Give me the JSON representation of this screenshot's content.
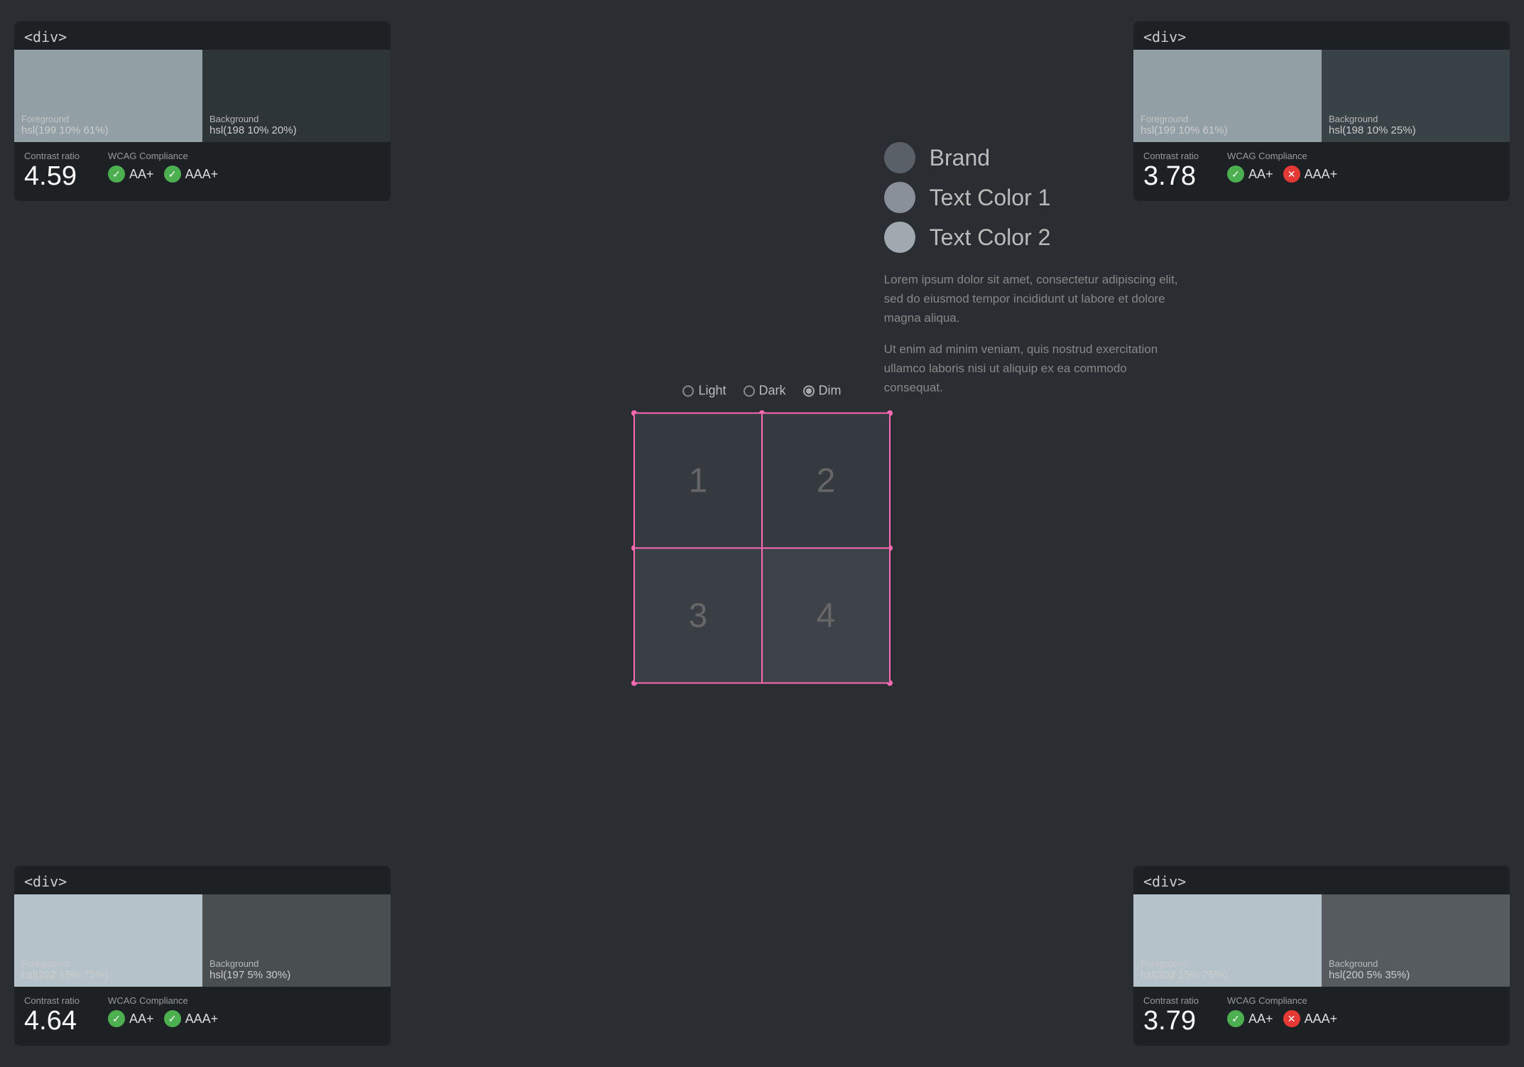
{
  "panels": {
    "tl": {
      "tag": "<div>",
      "fg_label": "Foreground",
      "fg_value": "hsl(199 10% 61%)",
      "bg_label": "Background",
      "bg_value": "hsl(198 10% 20%)",
      "contrast_label": "Contrast ratio",
      "contrast_value": "4.59",
      "wcag_label": "WCAG Compliance",
      "aa_label": "AA+",
      "aaa_label": "AAA+",
      "aa_pass": true,
      "aaa_pass": true
    },
    "tr": {
      "tag": "<div>",
      "fg_label": "Foreground",
      "fg_value": "hsl(199 10% 61%)",
      "bg_label": "Background",
      "bg_value": "hsl(198 10% 25%)",
      "contrast_label": "Contrast ratio",
      "contrast_value": "3.78",
      "wcag_label": "WCAG Compliance",
      "aa_label": "AA+",
      "aaa_label": "AAA+",
      "aa_pass": true,
      "aaa_pass": false
    },
    "bl": {
      "tag": "<div>",
      "fg_label": "Foreground",
      "fg_value": "hsl(202 15% 75%)",
      "bg_label": "Background",
      "bg_value": "hsl(197 5% 30%)",
      "contrast_label": "Contrast ratio",
      "contrast_value": "4.64",
      "wcag_label": "WCAG Compliance",
      "aa_label": "AA+",
      "aaa_label": "AAA+",
      "aa_pass": true,
      "aaa_pass": true
    },
    "br": {
      "tag": "<div>",
      "fg_label": "Foreground",
      "fg_value": "hsl(202 15% 75%)",
      "bg_label": "Background",
      "bg_value": "hsl(200 5% 35%)",
      "contrast_label": "Contrast ratio",
      "contrast_value": "3.79",
      "wcag_label": "WCAG Compliance",
      "aa_label": "AA+",
      "aaa_label": "AAA+",
      "aa_pass": true,
      "aaa_pass": false
    }
  },
  "theme_selector": {
    "options": [
      "Light",
      "Dark",
      "Dim"
    ],
    "selected": "Dim"
  },
  "grid": {
    "cells": [
      "1",
      "2",
      "3",
      "4"
    ]
  },
  "legend": {
    "items": [
      {
        "label": "Brand",
        "color": "#5a6068"
      },
      {
        "label": "Text Color 1",
        "color": "#8a9099"
      },
      {
        "label": "Text Color 2",
        "color": "#a0a8b0"
      }
    ]
  },
  "lorem": {
    "p1": "Lorem ipsum dolor sit amet, consectetur adipiscing elit, sed do eiusmod tempor incididunt ut labore et dolore magna aliqua.",
    "p2": "Ut enim ad minim veniam, quis nostrud exercitation ullamco laboris nisi ut aliquip ex ea commodo consequat."
  }
}
